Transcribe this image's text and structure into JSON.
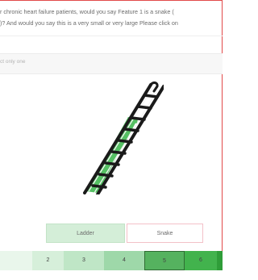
{
  "question": {
    "line1": "r chronic heart failure patients, would you say Feature 1 is a snake (",
    "line2": ")? And would you say this is a very small or very large Please click on"
  },
  "instruction": "ct only one",
  "image": {
    "icon": "ladder-icon"
  },
  "options": {
    "ladder": "Ladder",
    "snake": "Snake"
  },
  "scale": {
    "cells": [
      {
        "label": "",
        "color": "#e9f6eb"
      },
      {
        "label": "2",
        "color": "#d6efda"
      },
      {
        "label": "3",
        "color": "#bfe6c6"
      },
      {
        "label": "4",
        "color": "#9ed8a9"
      },
      {
        "label": "5",
        "color": "#55b25f"
      },
      {
        "label": "6",
        "color": "#42b34d"
      },
      {
        "label": "",
        "color": "#2f9d39"
      }
    ]
  }
}
